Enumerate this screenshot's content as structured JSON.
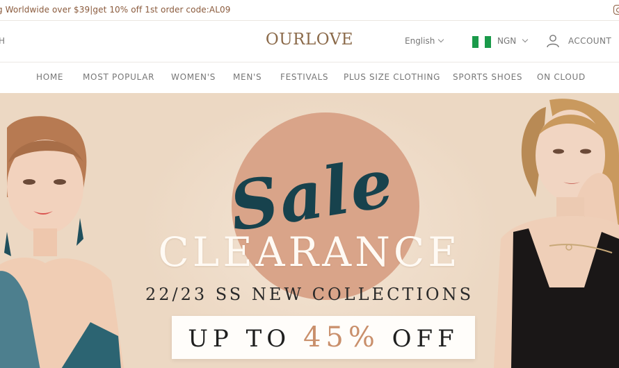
{
  "announcement": {
    "text": "g Worldwide over $39|get 10% off 1st order code:AL09",
    "social_icon": "instagram-icon"
  },
  "header": {
    "search_stub": "H",
    "logo": "OURLOVE",
    "language": "English",
    "currency": "NGN",
    "account_label": "ACCOUNT",
    "flag_colors": [
      "#1a9a4a",
      "#ffffff",
      "#1a9a4a"
    ]
  },
  "nav": {
    "items": [
      {
        "label": "HOME"
      },
      {
        "label": "MOST POPULAR"
      },
      {
        "label": "WOMEN'S"
      },
      {
        "label": "MEN'S"
      },
      {
        "label": "FESTIVALS"
      },
      {
        "label": "PLUS SIZE CLOTHING"
      },
      {
        "label": "SPORTS SHOES"
      },
      {
        "label": "ON CLOUD"
      }
    ]
  },
  "hero": {
    "script_word": "Sale",
    "headline": "CLEARANCE",
    "subheadline": "22/23 SS NEW COLLECTIONS",
    "offer_prefix": "UP TO ",
    "offer_percent": "45%",
    "offer_suffix": " OFF",
    "colors": {
      "background": "#ecd8c3",
      "circle": "#d9a489",
      "script": "#17424d",
      "accent": "#c98f6b"
    }
  }
}
